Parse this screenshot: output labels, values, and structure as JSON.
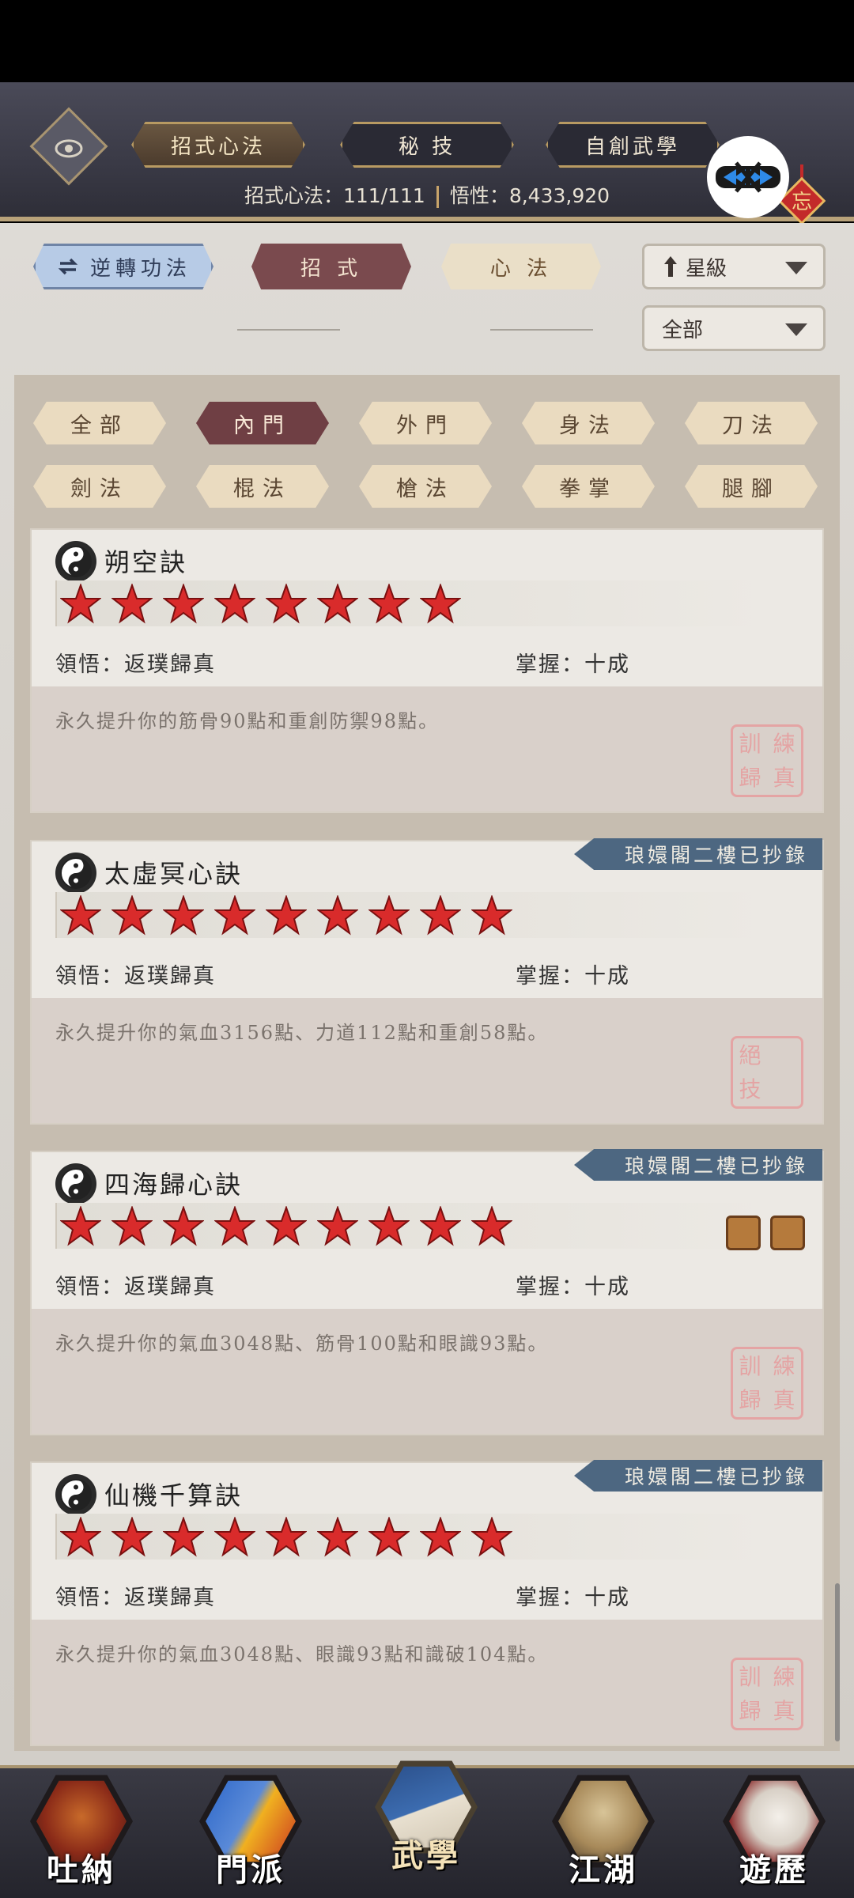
{
  "header": {
    "tabs": [
      {
        "label": "招式心法",
        "active": true
      },
      {
        "label": "秘 技",
        "active": false
      },
      {
        "label": "自創武學",
        "active": false
      }
    ],
    "stats": {
      "skills_label": "招式心法：",
      "skills_value": "111/111",
      "insight_label": "悟性：",
      "insight_value": "8,433,920"
    },
    "knot_char": "忘"
  },
  "filters": {
    "reverse_label": "逆轉功法",
    "moves_label": "招 式",
    "mental_label": "心 法",
    "sort_label": "星級",
    "scope_label": "全部"
  },
  "categories": [
    {
      "label": "全部",
      "active": false
    },
    {
      "label": "內門",
      "active": true
    },
    {
      "label": "外門",
      "active": false
    },
    {
      "label": "身法",
      "active": false
    },
    {
      "label": "刀法",
      "active": false
    },
    {
      "label": "劍法",
      "active": false
    },
    {
      "label": "棍法",
      "active": false
    },
    {
      "label": "槍法",
      "active": false
    },
    {
      "label": "拳掌",
      "active": false
    },
    {
      "label": "腿腳",
      "active": false
    }
  ],
  "cards": [
    {
      "name": "朔空訣",
      "stars": 8,
      "comprehension": "領悟：返璞歸真",
      "mastery": "掌握：十成",
      "description": "永久提升你的筋骨90點和重創防禦98點。",
      "badge": "",
      "seal": [
        "訓",
        "練",
        "歸",
        "真"
      ]
    },
    {
      "name": "太虛冥心訣",
      "stars": 9,
      "comprehension": "領悟：返璞歸真",
      "mastery": "掌握：十成",
      "description": "永久提升你的氣血3156點、力道112點和重創58點。",
      "badge": "琅嬛閣二樓已抄錄",
      "seal": [
        "絕",
        "",
        "技",
        ""
      ]
    },
    {
      "name": "四海歸心訣",
      "stars": 9,
      "comprehension": "領悟：返璞歸真",
      "mastery": "掌握：十成",
      "description": "永久提升你的氣血3048點、筋骨100點和眼識93點。",
      "badge": "琅嬛閣二樓已抄錄",
      "seal": [
        "訓",
        "練",
        "歸",
        "真"
      ]
    },
    {
      "name": "仙機千算訣",
      "stars": 9,
      "comprehension": "領悟：返璞歸真",
      "mastery": "掌握：十成",
      "description": "永久提升你的氣血3048點、眼識93點和識破104點。",
      "badge": "琅嬛閣二樓已抄錄",
      "seal": [
        "訓",
        "練",
        "歸",
        "真"
      ]
    }
  ],
  "bottom_nav": [
    {
      "label": "吐納",
      "icon": "monk-icon",
      "active": false
    },
    {
      "label": "門派",
      "icon": "flags-icon",
      "active": false
    },
    {
      "label": "武學",
      "icon": "book-icon",
      "active": true
    },
    {
      "label": "江湖",
      "icon": "straw-hat-icon",
      "active": false
    },
    {
      "label": "遊歷",
      "icon": "horse-icon",
      "active": false
    }
  ],
  "colors": {
    "star": "#d92b2b",
    "badge": "#4d6781",
    "active_category": "#6f3f44",
    "seal": "#e6a0a0"
  }
}
